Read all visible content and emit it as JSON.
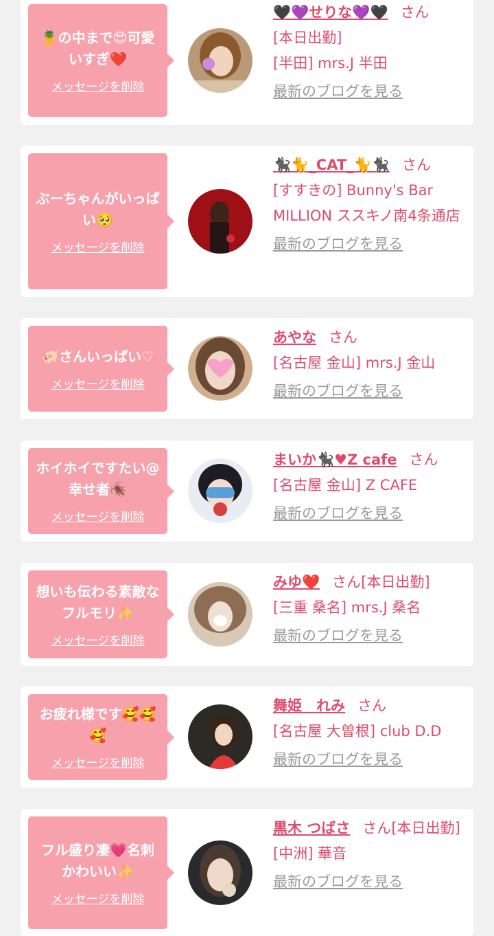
{
  "colors": {
    "page_bg": "#f1f1f2",
    "bubble": "#f7a1ad",
    "accent": "#de4b6e",
    "link_gray": "#9a9a9a"
  },
  "delete_label": "メッセージを削除",
  "blog_label": "最新のブログを見る",
  "items": [
    {
      "message": "🍍の中まで😍可愛いすぎ❤️",
      "name": "🖤💜せりな💜🖤",
      "san": "さん",
      "status": "[本日出勤]",
      "shop": "[半田] mrs.J 半田",
      "avatar_icon": "girl-photo"
    },
    {
      "message": "ぶーちゃんがいっぱい🥺",
      "name": "🐈‍⬛🐈_CAT_🐈🐈‍⬛",
      "san": "さん",
      "status": "",
      "shop": "[すすきの] Bunny's Bar MILLION ススキノ南4条通店",
      "avatar_icon": "girl-photo"
    },
    {
      "message": "🐖さんいっぱい♡",
      "name": "あやな",
      "san": "さん",
      "status": "",
      "shop": "[名古屋 金山] mrs.J 金山",
      "avatar_icon": "girl-photo"
    },
    {
      "message": "ホイホイですたい@幸せ者🪳",
      "name": "まいか🐈‍⬛♥Z cafe",
      "san": "さん",
      "status": "",
      "shop": "[名古屋 金山] Z CAFE",
      "avatar_icon": "girl-photo"
    },
    {
      "message": "想いも伝わる素敵なフルモリ✨",
      "name": "みゆ❤️",
      "san": "さん",
      "status": "[本日出勤]",
      "shop": "[三重 桑名] mrs.J 桑名",
      "avatar_icon": "girl-photo"
    },
    {
      "message": "お疲れ様です🥰🥰🥰",
      "name": "舞姫　れみ",
      "san": "さん",
      "status": "",
      "shop": "[名古屋 大曽根] club D.D",
      "avatar_icon": "girl-photo"
    },
    {
      "message": "フル盛り凄💗名刺かわいい✨",
      "name": "黒木 つばさ",
      "san": "さん",
      "status": "[本日出勤]",
      "shop": "[中洲] 華音",
      "avatar_icon": "girl-photo"
    }
  ]
}
